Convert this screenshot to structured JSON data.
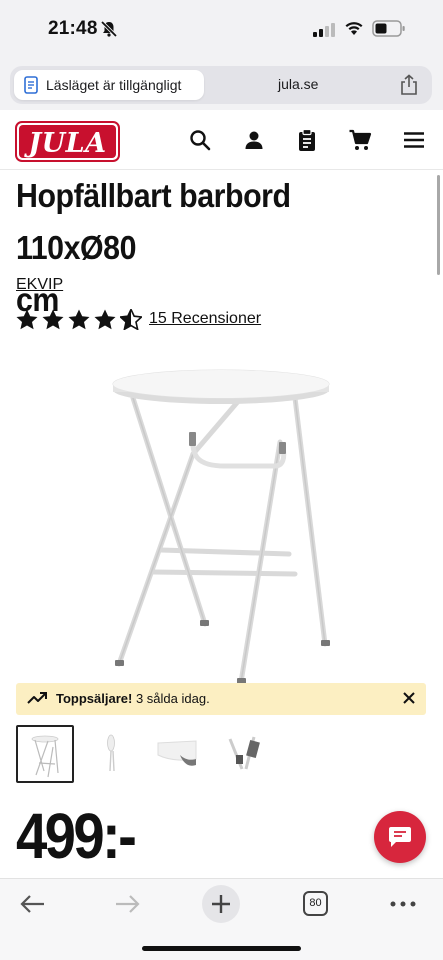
{
  "status_bar": {
    "time": "21:48"
  },
  "browser": {
    "reader_label": "Läsläget är tillgängligt",
    "domain": "jula.se",
    "tab_count": "80"
  },
  "site": {
    "logo_text": "JULA",
    "brand_color": "#c8102e"
  },
  "product": {
    "title_line1": "Hopfällbart barbord 110xØ80",
    "title_line2": "cm",
    "brand": "EKVIP",
    "rating": 4.5,
    "reviews_label": "15 Recensioner",
    "price": "499:-"
  },
  "banner": {
    "strong": "Toppsäljare!",
    "text": " 3 sålda idag.",
    "background": "#fcefc2"
  },
  "thumbnails": [
    "main-table",
    "folded-table",
    "table-top-detail",
    "leg-hinge-detail"
  ],
  "icons": {
    "header": [
      "search-icon",
      "user-icon",
      "clipboard-icon",
      "cart-icon",
      "menu-icon"
    ],
    "toolbar": [
      "back-icon",
      "forward-icon",
      "new-tab-icon",
      "tabs-icon",
      "more-icon"
    ]
  }
}
